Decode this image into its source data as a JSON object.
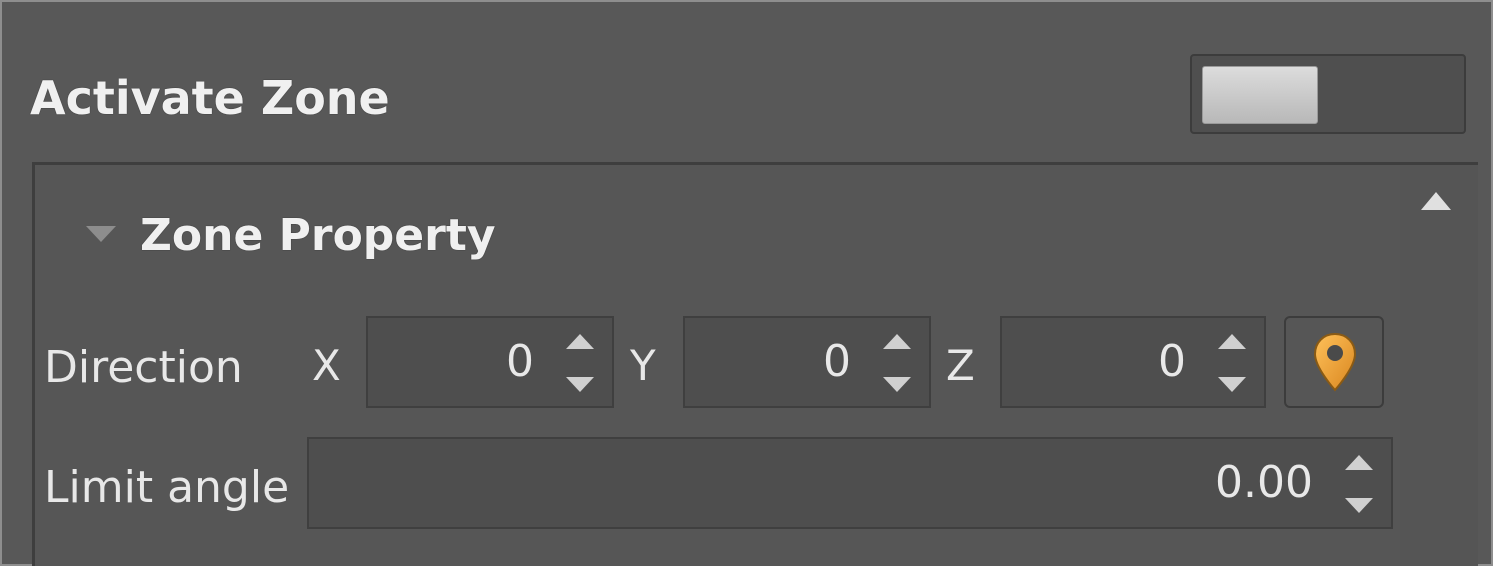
{
  "header": {
    "title": "Activate Zone",
    "toggle_on": false
  },
  "group": {
    "title": "Zone Property",
    "expanded": true
  },
  "direction": {
    "label": "Direction",
    "x_label": "X",
    "x_value": "0",
    "y_label": "Y",
    "y_value": "0",
    "z_label": "Z",
    "z_value": "0",
    "pick_icon": "location-pin-icon"
  },
  "limit_angle": {
    "label": "Limit angle",
    "value": "0.00"
  },
  "colors": {
    "panel_bg": "#585858",
    "field_bg": "#4e4e4e",
    "text": "#e8e8e8",
    "pin_accent": "#f0a23a"
  }
}
